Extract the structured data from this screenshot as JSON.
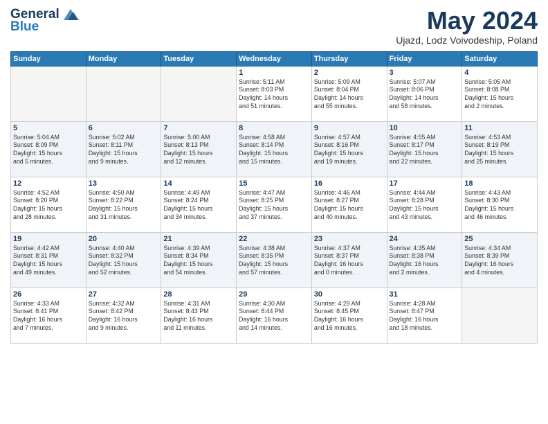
{
  "header": {
    "logo_line1": "General",
    "logo_line2": "Blue",
    "month_year": "May 2024",
    "location": "Ujazd, Lodz Voivodeship, Poland"
  },
  "weekdays": [
    "Sunday",
    "Monday",
    "Tuesday",
    "Wednesday",
    "Thursday",
    "Friday",
    "Saturday"
  ],
  "weeks": [
    [
      {
        "day": "",
        "info": ""
      },
      {
        "day": "",
        "info": ""
      },
      {
        "day": "",
        "info": ""
      },
      {
        "day": "1",
        "info": "Sunrise: 5:11 AM\nSunset: 8:03 PM\nDaylight: 14 hours\nand 51 minutes."
      },
      {
        "day": "2",
        "info": "Sunrise: 5:09 AM\nSunset: 8:04 PM\nDaylight: 14 hours\nand 55 minutes."
      },
      {
        "day": "3",
        "info": "Sunrise: 5:07 AM\nSunset: 8:06 PM\nDaylight: 14 hours\nand 58 minutes."
      },
      {
        "day": "4",
        "info": "Sunrise: 5:05 AM\nSunset: 8:08 PM\nDaylight: 15 hours\nand 2 minutes."
      }
    ],
    [
      {
        "day": "5",
        "info": "Sunrise: 5:04 AM\nSunset: 8:09 PM\nDaylight: 15 hours\nand 5 minutes."
      },
      {
        "day": "6",
        "info": "Sunrise: 5:02 AM\nSunset: 8:11 PM\nDaylight: 15 hours\nand 9 minutes."
      },
      {
        "day": "7",
        "info": "Sunrise: 5:00 AM\nSunset: 8:13 PM\nDaylight: 15 hours\nand 12 minutes."
      },
      {
        "day": "8",
        "info": "Sunrise: 4:58 AM\nSunset: 8:14 PM\nDaylight: 15 hours\nand 15 minutes."
      },
      {
        "day": "9",
        "info": "Sunrise: 4:57 AM\nSunset: 8:16 PM\nDaylight: 15 hours\nand 19 minutes."
      },
      {
        "day": "10",
        "info": "Sunrise: 4:55 AM\nSunset: 8:17 PM\nDaylight: 15 hours\nand 22 minutes."
      },
      {
        "day": "11",
        "info": "Sunrise: 4:53 AM\nSunset: 8:19 PM\nDaylight: 15 hours\nand 25 minutes."
      }
    ],
    [
      {
        "day": "12",
        "info": "Sunrise: 4:52 AM\nSunset: 8:20 PM\nDaylight: 15 hours\nand 28 minutes."
      },
      {
        "day": "13",
        "info": "Sunrise: 4:50 AM\nSunset: 8:22 PM\nDaylight: 15 hours\nand 31 minutes."
      },
      {
        "day": "14",
        "info": "Sunrise: 4:49 AM\nSunset: 8:24 PM\nDaylight: 15 hours\nand 34 minutes."
      },
      {
        "day": "15",
        "info": "Sunrise: 4:47 AM\nSunset: 8:25 PM\nDaylight: 15 hours\nand 37 minutes."
      },
      {
        "day": "16",
        "info": "Sunrise: 4:46 AM\nSunset: 8:27 PM\nDaylight: 15 hours\nand 40 minutes."
      },
      {
        "day": "17",
        "info": "Sunrise: 4:44 AM\nSunset: 8:28 PM\nDaylight: 15 hours\nand 43 minutes."
      },
      {
        "day": "18",
        "info": "Sunrise: 4:43 AM\nSunset: 8:30 PM\nDaylight: 15 hours\nand 46 minutes."
      }
    ],
    [
      {
        "day": "19",
        "info": "Sunrise: 4:42 AM\nSunset: 8:31 PM\nDaylight: 15 hours\nand 49 minutes."
      },
      {
        "day": "20",
        "info": "Sunrise: 4:40 AM\nSunset: 8:32 PM\nDaylight: 15 hours\nand 52 minutes."
      },
      {
        "day": "21",
        "info": "Sunrise: 4:39 AM\nSunset: 8:34 PM\nDaylight: 15 hours\nand 54 minutes."
      },
      {
        "day": "22",
        "info": "Sunrise: 4:38 AM\nSunset: 8:35 PM\nDaylight: 15 hours\nand 57 minutes."
      },
      {
        "day": "23",
        "info": "Sunrise: 4:37 AM\nSunset: 8:37 PM\nDaylight: 16 hours\nand 0 minutes."
      },
      {
        "day": "24",
        "info": "Sunrise: 4:35 AM\nSunset: 8:38 PM\nDaylight: 16 hours\nand 2 minutes."
      },
      {
        "day": "25",
        "info": "Sunrise: 4:34 AM\nSunset: 8:39 PM\nDaylight: 16 hours\nand 4 minutes."
      }
    ],
    [
      {
        "day": "26",
        "info": "Sunrise: 4:33 AM\nSunset: 8:41 PM\nDaylight: 16 hours\nand 7 minutes."
      },
      {
        "day": "27",
        "info": "Sunrise: 4:32 AM\nSunset: 8:42 PM\nDaylight: 16 hours\nand 9 minutes."
      },
      {
        "day": "28",
        "info": "Sunrise: 4:31 AM\nSunset: 8:43 PM\nDaylight: 16 hours\nand 11 minutes."
      },
      {
        "day": "29",
        "info": "Sunrise: 4:30 AM\nSunset: 8:44 PM\nDaylight: 16 hours\nand 14 minutes."
      },
      {
        "day": "30",
        "info": "Sunrise: 4:29 AM\nSunset: 8:45 PM\nDaylight: 16 hours\nand 16 minutes."
      },
      {
        "day": "31",
        "info": "Sunrise: 4:28 AM\nSunset: 8:47 PM\nDaylight: 16 hours\nand 18 minutes."
      },
      {
        "day": "",
        "info": ""
      }
    ]
  ]
}
